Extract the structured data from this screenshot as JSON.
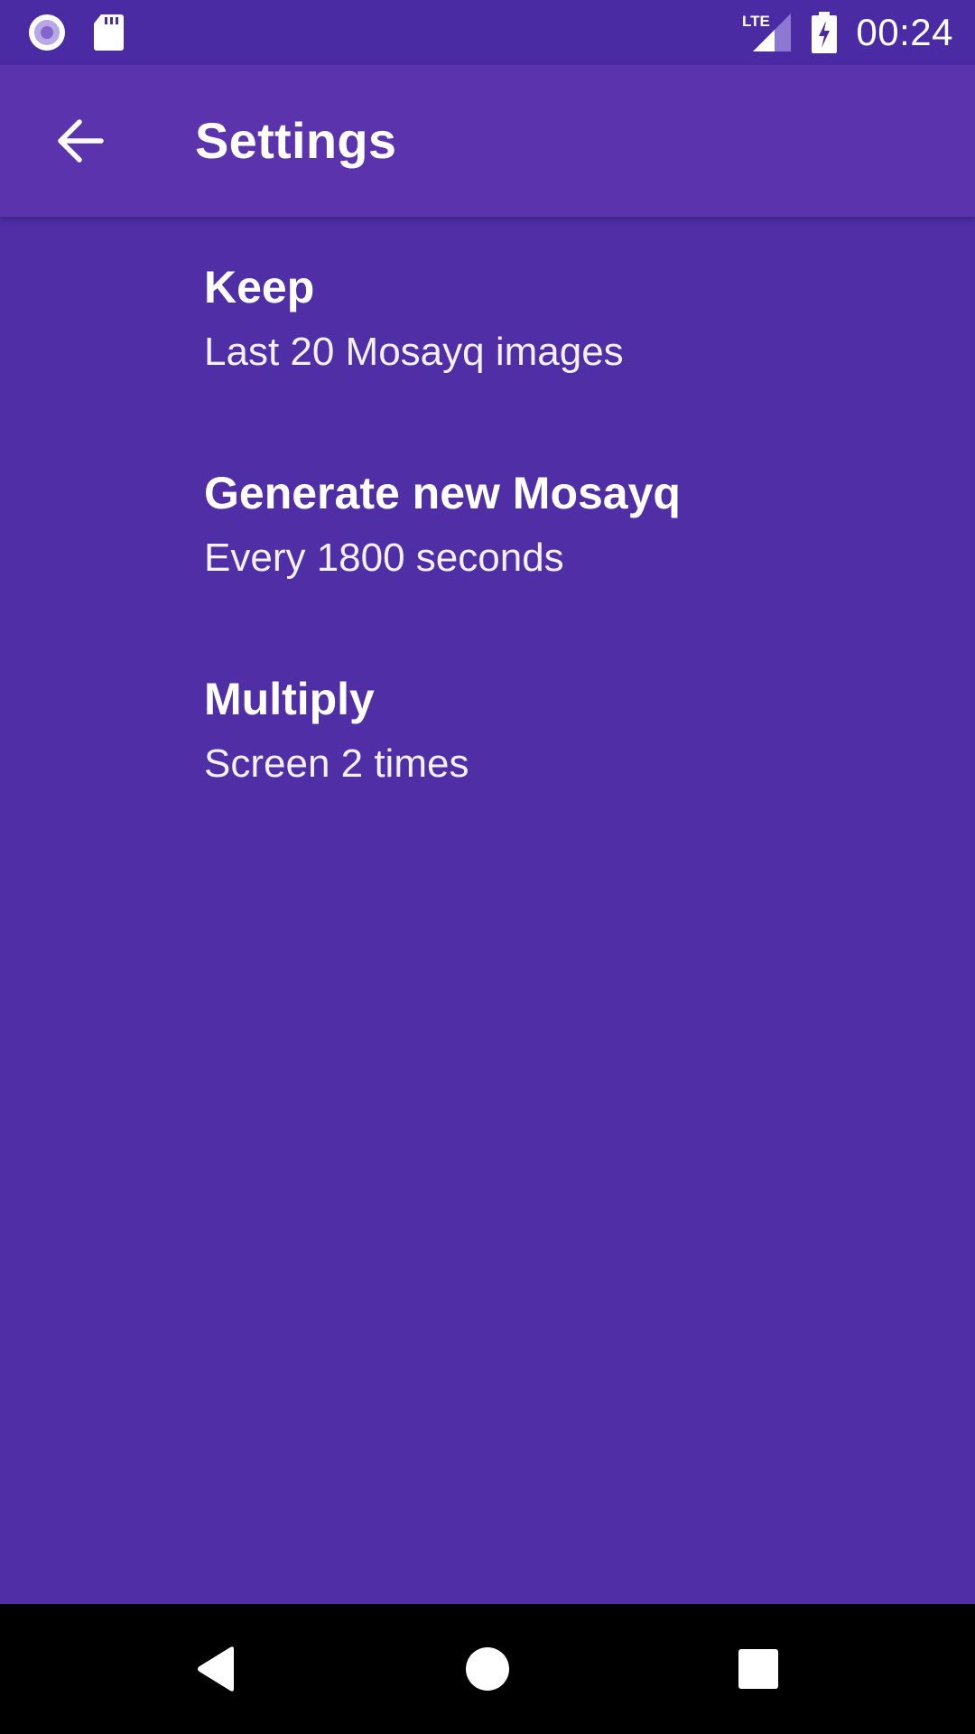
{
  "status_bar": {
    "time": "00:24",
    "network_label": "LTE",
    "left_icons": [
      "recording-icon",
      "sd-card-icon"
    ],
    "right_icons": [
      "lte-signal-icon",
      "battery-charging-icon"
    ]
  },
  "app_bar": {
    "title": "Settings",
    "back_icon": "arrow-back-icon"
  },
  "preferences": [
    {
      "title": "Keep",
      "summary": "Last 20 Mosayq images"
    },
    {
      "title": "Generate new Mosayq",
      "summary": "Every 1800 seconds"
    },
    {
      "title": "Multiply",
      "summary": "Screen 2 times"
    }
  ],
  "nav_bar": {
    "buttons": [
      "back-triangle-icon",
      "home-circle-icon",
      "recents-square-icon"
    ]
  },
  "colors": {
    "status_bar": "#4b2ba3",
    "app_bar": "#5a33ad",
    "background": "#4f2ea6",
    "nav_bar": "#000000",
    "text": "#ffffff"
  }
}
